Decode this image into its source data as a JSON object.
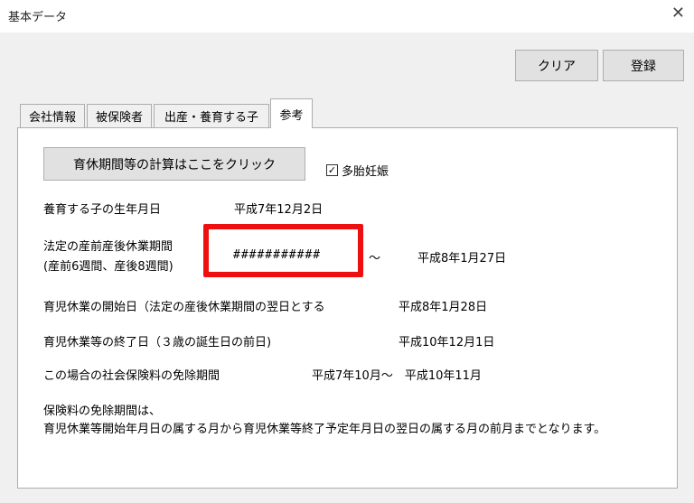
{
  "window": {
    "title": "基本データ",
    "close_glyph": "✕"
  },
  "toolbar": {
    "clear_label": "クリア",
    "register_label": "登録"
  },
  "tabs": [
    {
      "label": "会社情報"
    },
    {
      "label": "被保険者"
    },
    {
      "label": "出産・養育する子"
    },
    {
      "label": "参考"
    }
  ],
  "calc_button_label": "育休期間等の計算はここをクリック",
  "checkbox": {
    "label": "多胎妊娠",
    "checked_glyph": "✓"
  },
  "fields": {
    "birth_label": "養育する子の生年月日",
    "birth_value": "平成7年12月2日",
    "leave_label_line1": "法定の産前産後休業期間",
    "leave_label_line2": "(産前6週間、産後8週間)",
    "leave_start_value": "###########",
    "tilde": "～",
    "leave_end_value": "平成8年1月27日",
    "start_label": "育児休業の開始日（法定の産後休業期間の翌日とする",
    "start_value": "平成8年1月28日",
    "end_label": "育児休業等の終了日（３歳の誕生日の前日)",
    "end_value": "平成10年12月1日",
    "exempt_label": "この場合の社会保険料の免除期間",
    "exempt_value": "平成7年10月～　平成10年11月"
  },
  "note": {
    "line1": "保険料の免除期間は、",
    "line2": "育児休業等開始年月日の属する月から育児休業等終了予定年月日の翌日の属する月の前月までとなります。"
  },
  "colors": {
    "highlight": "#ee1010"
  }
}
